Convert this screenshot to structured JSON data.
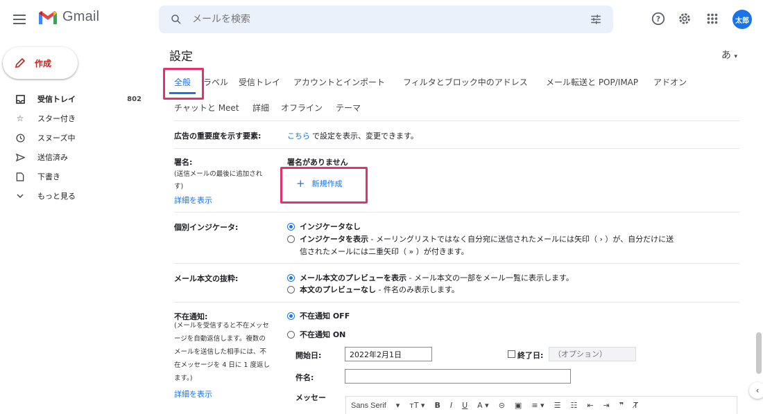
{
  "header": {
    "app_name": "Gmail",
    "search_placeholder": "メールを検索",
    "avatar_text": "太郎"
  },
  "sidebar": {
    "compose_label": "作成",
    "items": [
      {
        "label": "受信トレイ",
        "count": "802",
        "icon": "inbox-icon",
        "bold": true
      },
      {
        "label": "スター付き",
        "icon": "star-icon"
      },
      {
        "label": "スヌーズ中",
        "icon": "clock-icon"
      },
      {
        "label": "送信済み",
        "icon": "send-icon"
      },
      {
        "label": "下書き",
        "icon": "draft-icon"
      },
      {
        "label": "もっと見る",
        "icon": "chevron-down-icon"
      }
    ]
  },
  "main": {
    "title": "設定",
    "lang_label": "あ",
    "tabs_row1": [
      "全般",
      "ラベル",
      "受信トレイ",
      "アカウントとインポート",
      "フィルタとブロック中のアドレス",
      "メール転送と POP/IMAP",
      "アドオン"
    ],
    "tabs_row2": [
      "チャットと Meet",
      "詳細",
      "オフライン",
      "テーマ"
    ],
    "ads": {
      "label": "広告の重要度を示す要素:",
      "link": "こちら",
      "text": "で設定を表示、変更できます。"
    },
    "signature": {
      "label": "署名:",
      "sub_line1": "(送信メールの最後に追加され",
      "sub_line2": "す)",
      "details_link": "詳細を表示",
      "none_text": "署名がありません",
      "new_button": "新規作成"
    },
    "indicator": {
      "label": "個別インジケータ:",
      "opt1": "インジケータなし",
      "opt2_bold": "インジケータを表示",
      "opt2_line1": " - メーリングリストではなく自分宛に送信されたメールには矢印（ › ）が、自分だけに送",
      "opt2_line2": "信されたメールには二重矢印（ » ）が付きます。"
    },
    "snippets": {
      "label": "メール本文の抜粋:",
      "opt1_bold": "メール本文のプレビューを表示",
      "opt1_text": " - メール本文の一部をメール一覧に表示します。",
      "opt2_bold": "本文のプレビューなし",
      "opt2_text": " - 件名のみ表示します。"
    },
    "vacation": {
      "label": "不在通知:",
      "sub_lines": [
        "(メールを受信すると不在メッセ",
        "ージを自動返信します。複数の",
        "メールを送信した相手には、不",
        "在メッセージを 4 日に 1 度返し",
        "ます。)"
      ],
      "details_link": "詳細を表示",
      "off_label": "不在通知 OFF",
      "on_label": "不在通知 ON",
      "start_label": "開始日:",
      "start_value": "2022年2月1日",
      "end_label": "終了日:",
      "end_placeholder": "（オプション）",
      "subject_label": "件名:",
      "message_label": "メッセー"
    },
    "toolbar": {
      "font": "Sans Serif",
      "items": [
        "▾",
        "ᴛT ▾",
        "B",
        "I",
        "U",
        "A ▾",
        "⊝",
        "▣",
        "≡ ▾",
        "☰",
        "☷",
        "⇤",
        "⇥",
        "❞",
        "T̸"
      ]
    }
  },
  "colors": {
    "accent": "#1a73e8",
    "highlight": "#e3326a",
    "compose_icon": "#c5221f"
  }
}
